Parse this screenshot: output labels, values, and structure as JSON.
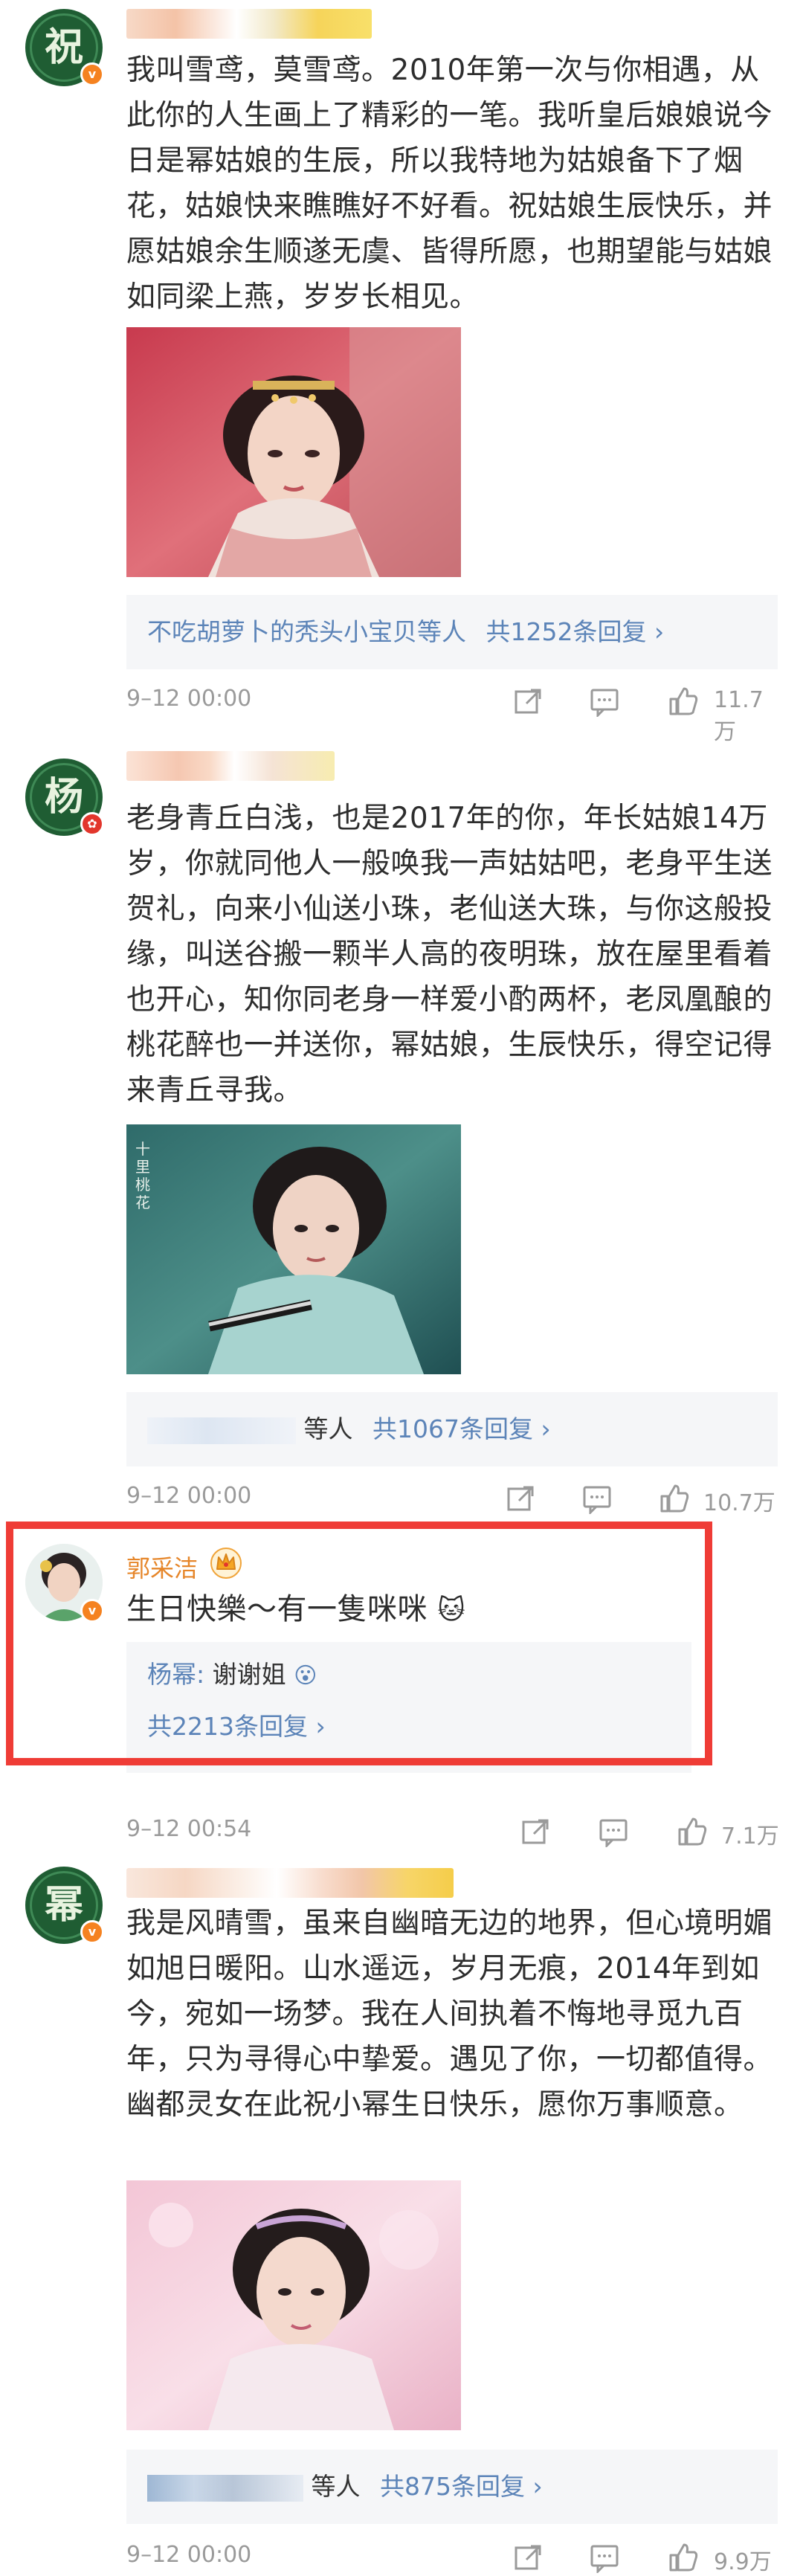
{
  "comments": [
    {
      "avatar_char": "祝",
      "text": "我叫雪鸢，莫雪鸢。2010年第一次与你相遇，从此你的人生画上了精彩的一笔。我听皇后娘娘说今日是幂姑娘的生辰，所以我特地为姑娘备下了烟花，姑娘快来瞧瞧好不好看。祝姑娘生辰快乐，并愿姑娘余生顺遂无虞、皆得所愿，也期望能与姑娘如同梁上燕，岁岁长相见。",
      "reply_summary": "不吃胡萝卜的秃头小宝贝等人",
      "reply_count": "共1252条回复 ›",
      "time": "9–12 00:00",
      "likes": "11.7万"
    },
    {
      "avatar_char": "杨",
      "text": "老身青丘白浅，也是2017年的你，年长姑娘14万岁，你就同他人一般唤我一声姑姑吧，老身平生送贺礼，向来小仙送小珠，老仙送大珠，与你这般投缘，叫送谷搬一颗半人高的夜明珠，放在屋里看着也开心，知你同老身一样爱小酌两杯，老凤凰酿的桃花醉也一并送你，幂姑娘，生辰快乐，得空记得来青丘寻我。",
      "reply_summary": "等人",
      "reply_count": "共1067条回复 ›",
      "time": "9–12 00:00",
      "likes": "10.7万"
    },
    {
      "name": "郭采洁",
      "text": "生日快樂～有一隻咪咪",
      "reply_author": "杨幂",
      "reply_text": "谢谢姐",
      "reply_count": "共2213条回复 ›",
      "time": "9–12 00:54",
      "likes": "7.1万"
    },
    {
      "avatar_char": "幂",
      "text": "我是风晴雪，虽来自幽暗无边的地界，但心境明媚如旭日暖阳。山水遥远，岁月无痕，2014年到如今，宛如一场梦。我在人间执着不悔地寻觅九百年，只为寻得心中挚爱。遇见了你，一切都值得。幽都灵女在此祝小幂生日快乐，愿你万事顺意。",
      "reply_summary": "等人",
      "reply_count": "共875条回复 ›",
      "time": "9–12 00:00",
      "likes": "9.9万"
    }
  ],
  "colors": {
    "link": "#5c84b8",
    "meta": "#9a9a9a",
    "highlight": "#ef3c36",
    "verified": "#f58220"
  }
}
